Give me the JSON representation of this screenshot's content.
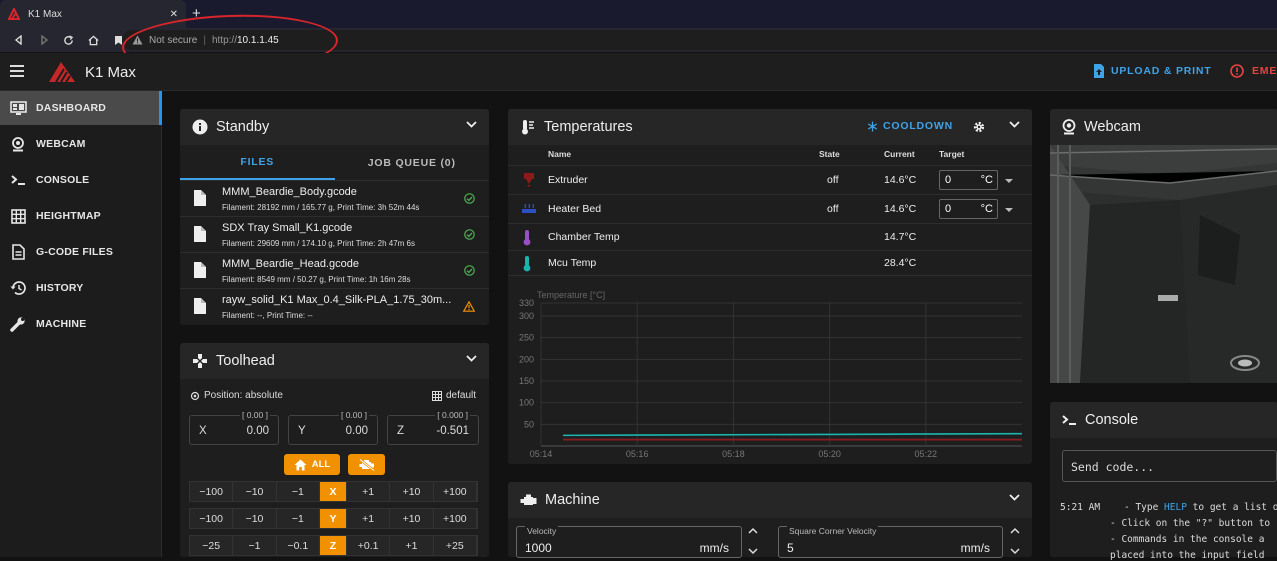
{
  "browser": {
    "tab_title": "K1 Max",
    "new_tab": "+",
    "security": "Not secure",
    "url_scheme": "http://",
    "url_host": "10.1.1.45"
  },
  "header": {
    "title": "K1 Max",
    "upload_label": "UPLOAD & PRINT",
    "emergency_label": "EME",
    "accent": "#3fa3e8",
    "danger": "#e84343"
  },
  "sidebar": {
    "items": [
      {
        "label": "DASHBOARD",
        "icon": "monitor-dashboard-icon"
      },
      {
        "label": "WEBCAM",
        "icon": "webcam-icon"
      },
      {
        "label": "CONSOLE",
        "icon": "console-icon"
      },
      {
        "label": "HEIGHTMAP",
        "icon": "grid-icon"
      },
      {
        "label": "G-CODE FILES",
        "icon": "file-document-icon"
      },
      {
        "label": "HISTORY",
        "icon": "history-icon"
      },
      {
        "label": "MACHINE",
        "icon": "wrench-icon"
      }
    ],
    "active": "DASHBOARD"
  },
  "status_card": {
    "title": "Standby",
    "tabs": [
      "FILES",
      "JOB QUEUE (0)"
    ],
    "files": [
      {
        "name": "MMM_Beardie_Body.gcode",
        "meta": "Filament: 28192 mm / 165.77 g, Print Time: 3h 52m 44s",
        "status": "ok"
      },
      {
        "name": "SDX Tray Small_K1.gcode",
        "meta": "Filament: 29609 mm / 174.10 g, Print Time: 2h 47m 6s",
        "status": "ok"
      },
      {
        "name": "MMM_Beardie_Head.gcode",
        "meta": "Filament: 8549 mm / 50.27 g, Print Time: 1h 16m 28s",
        "status": "ok"
      },
      {
        "name": "rayw_solid_K1 Max_0.4_Silk-PLA_1.75_30m...",
        "meta": "Filament: --, Print Time: --",
        "status": "warning"
      }
    ]
  },
  "toolhead": {
    "title": "Toolhead",
    "position_label": "Position: absolute",
    "profile_label": "default",
    "positions": [
      {
        "axis": "X",
        "value": "0.00",
        "bracket": "[ 0.00 ]"
      },
      {
        "axis": "Y",
        "value": "0.00",
        "bracket": "[ 0.00 ]"
      },
      {
        "axis": "Z",
        "value": "-0.501",
        "bracket": "[ 0.000 ]"
      }
    ],
    "home_all_label": "ALL",
    "jog": [
      {
        "axis": "X",
        "minus": [
          "−100",
          "−10",
          "−1"
        ],
        "plus": [
          "+1",
          "+10",
          "+100"
        ]
      },
      {
        "axis": "Y",
        "minus": [
          "−100",
          "−10",
          "−1"
        ],
        "plus": [
          "+1",
          "+10",
          "+100"
        ]
      },
      {
        "axis": "Z",
        "minus": [
          "−25",
          "−1",
          "−0.1"
        ],
        "plus": [
          "+0.1",
          "+1",
          "+25"
        ]
      }
    ],
    "accent": "#f29100"
  },
  "temperatures": {
    "title": "Temperatures",
    "cooldown_label": "COOLDOWN",
    "columns": [
      "Name",
      "State",
      "Current",
      "Target"
    ],
    "rows": [
      {
        "name": "Extruder",
        "state": "off",
        "current": "14.6°C",
        "target": "0",
        "unit": "°C",
        "color": "#8b1a1a"
      },
      {
        "name": "Heater Bed",
        "state": "off",
        "current": "14.6°C",
        "target": "0",
        "unit": "°C",
        "color": "#2b50c4"
      },
      {
        "name": "Chamber Temp",
        "state": "",
        "current": "14.7°C",
        "target": "",
        "unit": "",
        "color": "#9b4fc6"
      },
      {
        "name": "Mcu Temp",
        "state": "",
        "current": "28.4°C",
        "target": "",
        "unit": "",
        "color": "#1bb5b0"
      }
    ]
  },
  "chart_data": {
    "type": "line",
    "ylabel": "Temperature [°C]",
    "ylim": [
      0,
      330
    ],
    "yticks": [
      50,
      100,
      150,
      200,
      250,
      300,
      330
    ],
    "x": [
      "05:14",
      "05:16",
      "05:18",
      "05:20",
      "05:22"
    ],
    "x_range": [
      "05:14",
      "05:24"
    ],
    "grid": true,
    "series": [
      {
        "name": "Mcu Temp",
        "color": "#1bb5b0",
        "values": [
          24.5,
          25.5,
          26.5,
          27.5,
          28.4
        ]
      },
      {
        "name": "Chamber Temp",
        "color": "#9b4fc6",
        "values": [
          14.7,
          14.7,
          14.7,
          14.7,
          14.7
        ]
      },
      {
        "name": "Extruder",
        "color": "#8b1a1a",
        "values": [
          14.6,
          14.6,
          14.6,
          14.6,
          14.6
        ]
      }
    ]
  },
  "machine": {
    "title": "Machine",
    "fields": [
      {
        "label": "Velocity",
        "value": "1000",
        "unit": "mm/s"
      },
      {
        "label": "Square Corner Velocity",
        "value": "5",
        "unit": "mm/s"
      }
    ]
  },
  "webcam": {
    "title": "Webcam"
  },
  "console": {
    "title": "Console",
    "placeholder": "Send code...",
    "time": "5:21 AM",
    "lines": [
      "- Type ",
      "HELP",
      " to get a list of",
      "- Click on the \"?\" button to",
      "- Commands in the console a",
      "placed into the input field"
    ]
  }
}
